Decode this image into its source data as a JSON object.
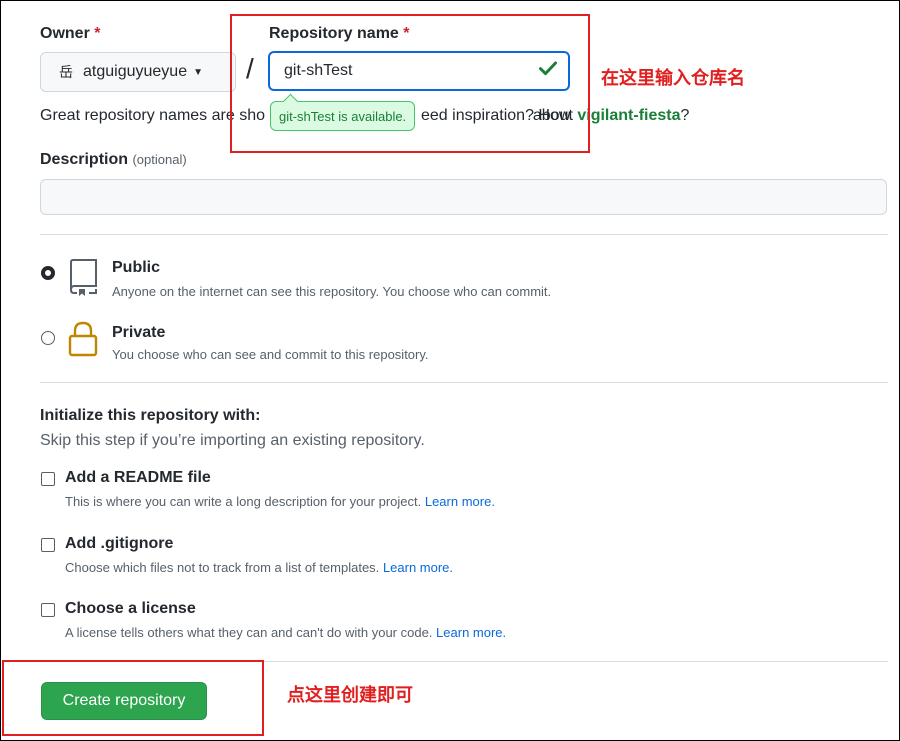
{
  "owner": {
    "label": "Owner",
    "required_mark": "*",
    "selected": "atguiguyueyue",
    "avatar_glyph": "岳"
  },
  "separator": "/",
  "repo_name": {
    "label": "Repository name",
    "required_mark": "*",
    "value": "git-shTest",
    "availability_tip": "git-shTest is available."
  },
  "hint": {
    "text_left": "Great repository names are sho",
    "text_mid": "eed inspiration? How ",
    "text_about": "about ",
    "suggestion": "vigilant-fiesta",
    "suffix": "?"
  },
  "description": {
    "label": "Description",
    "optional": "(optional)",
    "value": ""
  },
  "visibility": [
    {
      "title": "Public",
      "subtitle": "Anyone on the internet can see this repository. You choose who can commit.",
      "selected": true,
      "icon": "repo-icon"
    },
    {
      "title": "Private",
      "subtitle": "You choose who can see and commit to this repository.",
      "selected": false,
      "icon": "lock-icon"
    }
  ],
  "initialize": {
    "title": "Initialize this repository with:",
    "subtitle": "Skip this step if you’re importing an existing repository.",
    "options": [
      {
        "title": "Add a README file",
        "subtitle": "This is where you can write a long description for your project.",
        "link": "Learn more.",
        "checked": false
      },
      {
        "title": "Add .gitignore",
        "subtitle": "Choose which files not to track from a list of templates.",
        "link": "Learn more.",
        "checked": false
      },
      {
        "title": "Choose a license",
        "subtitle": "A license tells others what they can and can't do with your code.",
        "link": "Learn more.",
        "checked": false
      }
    ]
  },
  "create_button": "Create repository",
  "annotations": {
    "name": "在这里输入仓库名",
    "create": "点这里创建即可",
    "color": "#e02020"
  },
  "colors": {
    "primary_button": "#2da44e",
    "focus_border": "#0969da",
    "success_text": "#1a7f37"
  }
}
